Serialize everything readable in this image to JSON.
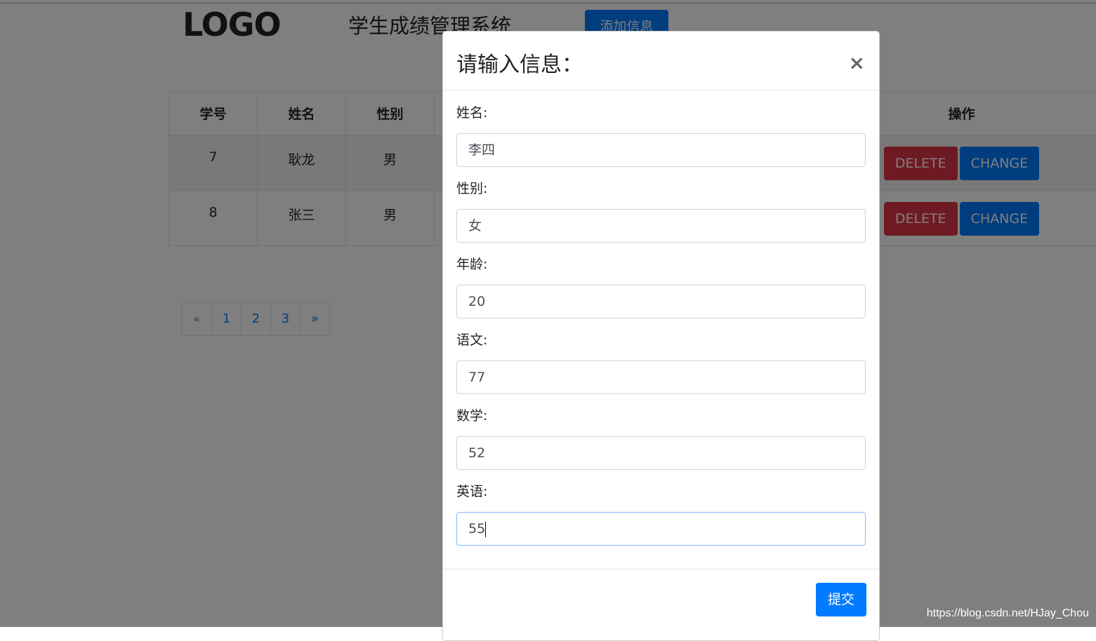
{
  "header": {
    "logo": "LOGO",
    "title": "学生成绩管理系统",
    "add_button": "添加信息"
  },
  "table": {
    "columns": [
      "学号",
      "姓名",
      "性别",
      "操作"
    ],
    "rows": [
      {
        "id": "7",
        "name": "耿龙",
        "gender": "男"
      },
      {
        "id": "8",
        "name": "张三",
        "gender": "男"
      }
    ],
    "delete_label": "DELETE",
    "change_label": "CHANGE"
  },
  "pagination": {
    "prev": "«",
    "pages": [
      "1",
      "2",
      "3"
    ],
    "next": "»"
  },
  "modal": {
    "title": "请输入信息：",
    "close": "×",
    "fields": [
      {
        "label": "姓名:",
        "value": "李四"
      },
      {
        "label": "性别:",
        "value": "女"
      },
      {
        "label": "年龄:",
        "value": "20"
      },
      {
        "label": "语文:",
        "value": "77"
      },
      {
        "label": "数学:",
        "value": "52"
      },
      {
        "label": "英语:",
        "value": "55"
      }
    ],
    "submit": "提交"
  },
  "watermark": "https://blog.csdn.net/HJay_Chou",
  "colors": {
    "primary": "#007bff",
    "danger": "#dc3545"
  }
}
